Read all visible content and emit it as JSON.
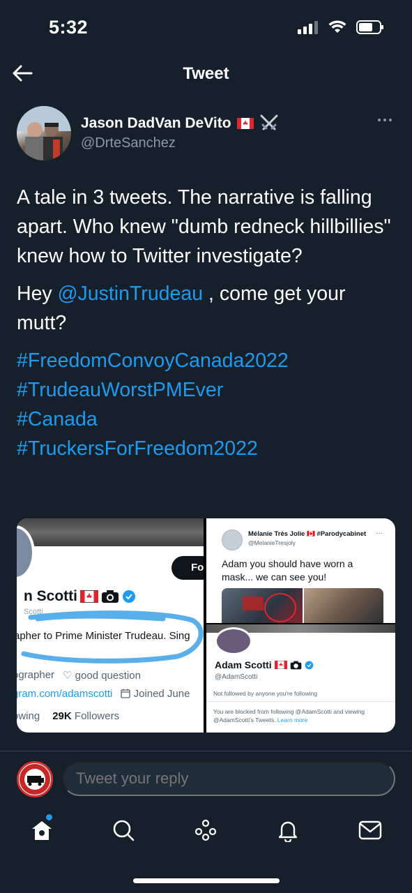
{
  "status_bar": {
    "time": "5:32"
  },
  "nav": {
    "title": "Tweet",
    "back_icon": "back-arrow-icon"
  },
  "author": {
    "name": "Jason DadVan DeVito",
    "handle": "@DrteSanchez",
    "badges": [
      "canada-flag-icon",
      "crossed-swords-icon"
    ]
  },
  "tweet": {
    "paragraph1": "A tale in 3 tweets. The narrative is falling apart. Who knew \"dumb redneck hillbillies\" knew how to Twitter investigate?",
    "hey_prefix": "Hey ",
    "mention": "@JustinTrudeau",
    "hey_suffix": " , come get your mutt?",
    "hashtags": [
      "#FreedomConvoyCanada2022",
      "#TrudeauWorstPMEver",
      "#Canada",
      "#TruckersForFreedom2022"
    ]
  },
  "media_left": {
    "follow_button": "Fo",
    "name": "n Scotti",
    "sub": "Scotti",
    "bio": "apher to Prime Minister Trudeau. Sing",
    "meta_job": "ographer",
    "meta_question": "good question",
    "meta_url": "gram.com/adamscotti",
    "meta_joined": "Joined June",
    "following_label": "owing",
    "followers_count": "29K",
    "followers_label": "Followers"
  },
  "media_right_top": {
    "name": "Mélanie Très Jolie 🇨🇦 #Parodycabinet",
    "handle": "@MelanieTresjoly",
    "dots": "···",
    "text": "Adam you should have worn a mask... we can see you!"
  },
  "media_right_bottom": {
    "name": "Adam Scotti",
    "handle": "@AdamScotti",
    "follow_note": "Not followed by anyone you're following",
    "blocked_text": "You are blocked from following @AdamScotti and viewing @AdamScotti's Tweets.",
    "learn_more": "Learn more"
  },
  "reply": {
    "placeholder": "Tweet your reply"
  },
  "tab_bar": {
    "items": [
      "home-icon",
      "search-icon",
      "spaces-icon",
      "notifications-icon",
      "messages-icon"
    ]
  },
  "colors": {
    "background": "#15202b",
    "accent": "#1d9bf0",
    "muted": "#8b98a5"
  }
}
